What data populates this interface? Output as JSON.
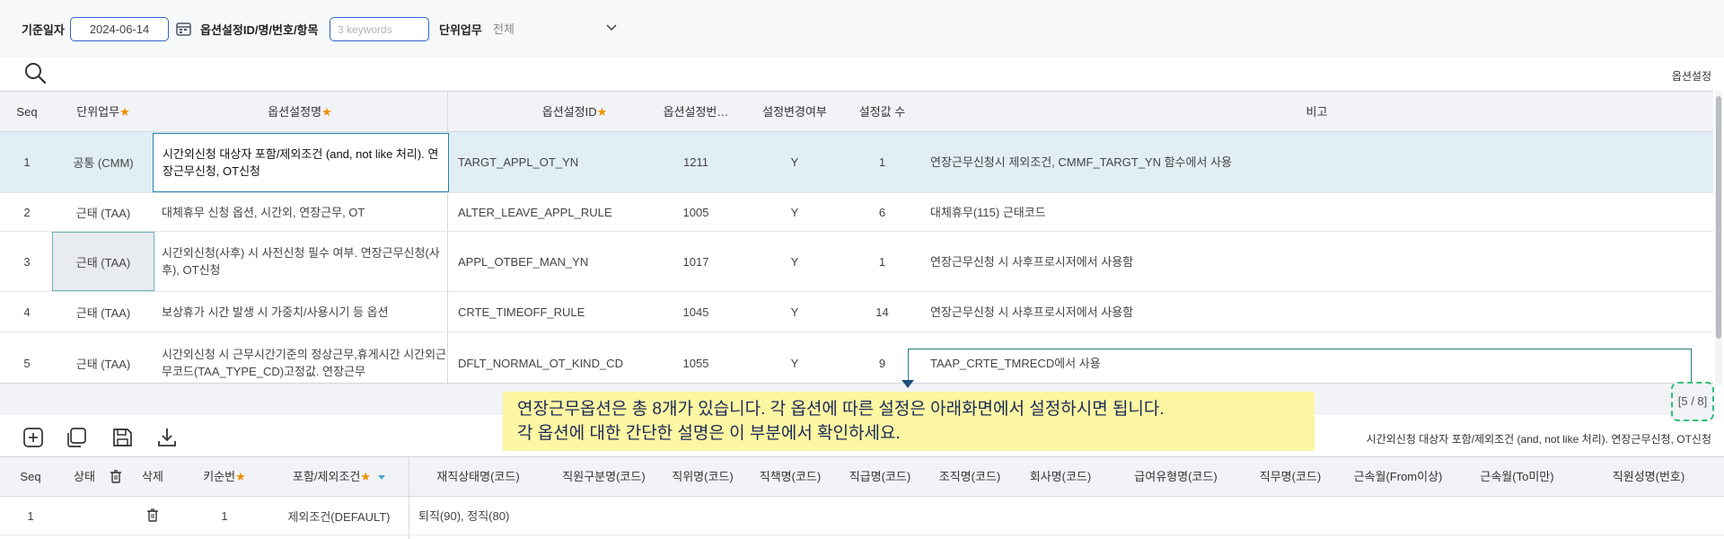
{
  "filters": {
    "base_date_label": "기준일자",
    "base_date_value": "2024-06-14",
    "option_label": "옵션설정ID/명/번호/항목",
    "option_placeholder": "3 keywords",
    "unit_label": "단위업무",
    "unit_value": "전체"
  },
  "top_section_title": "옵션설정",
  "top_grid": {
    "headers": {
      "seq": "Seq",
      "unit": "단위업무",
      "name": "옵션설정명",
      "id": "옵션설정ID",
      "no": "옵션설정번…",
      "changed": "설정변경여부",
      "count": "설정값 수",
      "note": "비고"
    },
    "rows": [
      {
        "seq": "1",
        "unit": "공통 (CMM)",
        "name": "시간외신청 대상자 포함/제외조건 (and, not like 처리). 연장근무신청, OT신청",
        "id": "TARGT_APPL_OT_YN",
        "no": "1211",
        "changed": "Y",
        "count": "1",
        "note": "연장근무신청시 제외조건, CMMF_TARGT_YN 함수에서 사용"
      },
      {
        "seq": "2",
        "unit": "근태 (TAA)",
        "name": "대체휴무 신청 옵션, 시간외, 연장근무, OT",
        "id": "ALTER_LEAVE_APPL_RULE",
        "no": "1005",
        "changed": "Y",
        "count": "6",
        "note": "대체휴무(115) 근태코드"
      },
      {
        "seq": "3",
        "unit": "근태 (TAA)",
        "name": "시간외신청(사후) 시 사전신청 필수 여부. 연장근무신청(사후), OT신청",
        "id": "APPL_OTBEF_MAN_YN",
        "no": "1017",
        "changed": "Y",
        "count": "1",
        "note": "연장근무신청 시 사후프로시저에서 사용함"
      },
      {
        "seq": "4",
        "unit": "근태 (TAA)",
        "name": "보상휴가 시간 발생 시 가중치/사용시기 등 옵션",
        "id": "CRTE_TIMEOFF_RULE",
        "no": "1045",
        "changed": "Y",
        "count": "14",
        "note": "연장근무신청 시 사후프로시저에서 사용함"
      },
      {
        "seq": "5",
        "unit": "근태 (TAA)",
        "name": "시간외신청 시 근무시간기준의 정상근무,휴게시간 시간외근무코드(TAA_TYPE_CD)고정값. 연장근무",
        "id": "DFLT_NORMAL_OT_KIND_CD",
        "no": "1055",
        "changed": "Y",
        "count": "9",
        "note": "TAAP_CRTE_TMRECD에서 사용"
      }
    ],
    "pager": "[5 / 8]"
  },
  "callout": {
    "line1": "연장근무옵션은 총 8개가 있습니다. 각 옵션에 따른 설정은 아래화면에서 설정하시면 됩니다.",
    "line2": "각 옵션에 대한 간단한 설명은 이 부분에서 확인하세요."
  },
  "detail_description": "시간외신청 대상자 포함/제외조건 (and, not like 처리). 연장근무신청, OT신청",
  "bottom_grid": {
    "headers": {
      "seq": "Seq",
      "status": "상태",
      "delete": "삭제",
      "key_no": "키순번",
      "include": "포함/제외조건",
      "emp_status": "재직상태명(코드)",
      "emp_type": "직원구분명(코드)",
      "position": "직위명(코드)",
      "duty": "직책명(코드)",
      "grade": "직급명(코드)",
      "org": "조직명(코드)",
      "company": "회사명(코드)",
      "pay_type": "급여유형명(코드)",
      "job": "직무명(코드)",
      "tenure_from": "근속월(From이상)",
      "tenure_to": "근속월(To미만)",
      "emp_name": "직원성명(번호)"
    },
    "rows": [
      {
        "seq": "1",
        "key_no": "1",
        "include": "제외조건(DEFAULT)",
        "emp_status": "퇴직(90), 정직(80)"
      }
    ]
  },
  "colors": {
    "accent": "#2e63c8",
    "required": "#f08c00",
    "selected_row": "#e2eef6",
    "callout_bg": "#fdf6a2",
    "pager_border": "#2fbf71"
  }
}
